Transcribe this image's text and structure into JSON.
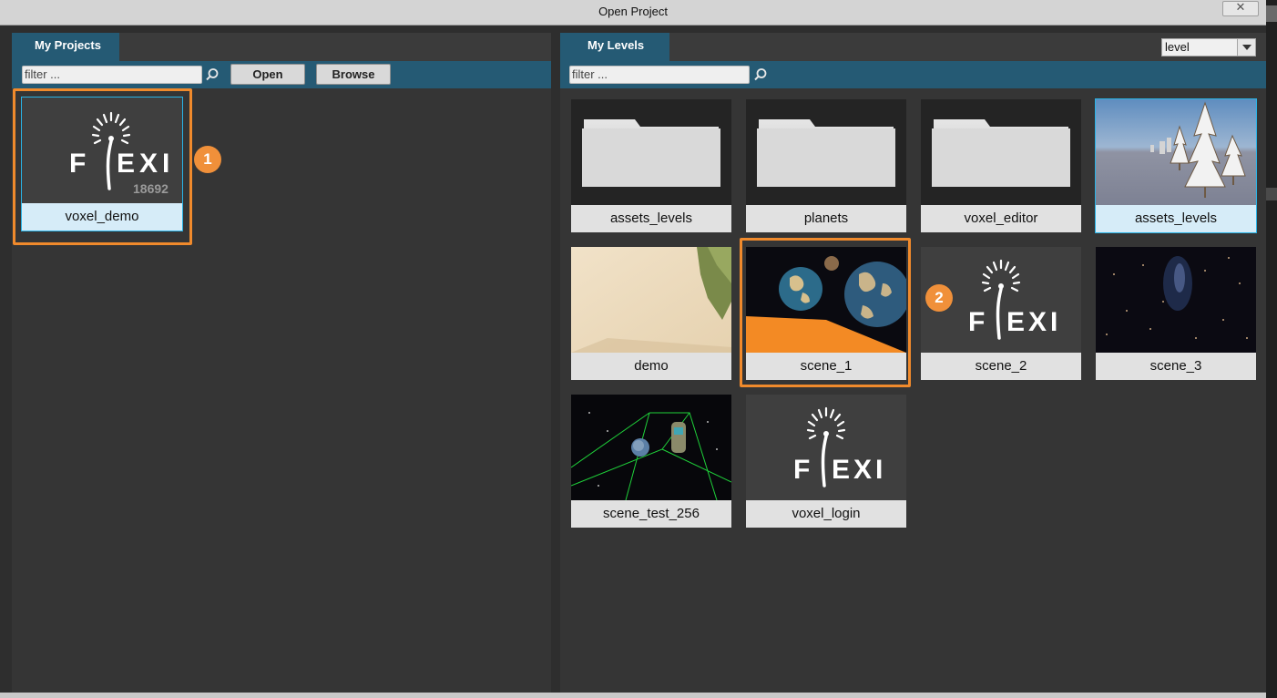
{
  "window": {
    "title": "Open Project",
    "close_glyph": "✕"
  },
  "projects": {
    "tab_label": "My Projects",
    "filter_placeholder": "filter ...",
    "open_label": "Open",
    "browse_label": "Browse",
    "items": [
      {
        "name": "voxel_demo",
        "thumb_number": "18692",
        "icon": "flexi-logo",
        "selected": true
      }
    ]
  },
  "levels": {
    "tab_label": "My Levels",
    "filter_placeholder": "filter ...",
    "type_select_value": "level",
    "items": [
      {
        "name": "assets_levels",
        "thumb": "folder-icon"
      },
      {
        "name": "planets",
        "thumb": "folder-icon"
      },
      {
        "name": "voxel_editor",
        "thumb": "folder-icon"
      },
      {
        "name": "assets_levels",
        "thumb": "snow-trees-scene",
        "selected": true
      },
      {
        "name": "demo",
        "thumb": "desert-scene"
      },
      {
        "name": "scene_1",
        "thumb": "planets-scene"
      },
      {
        "name": "scene_2",
        "thumb": "flexi-logo"
      },
      {
        "name": "scene_3",
        "thumb": "nebula-scene"
      },
      {
        "name": "scene_test_256",
        "thumb": "space-wireframe-scene"
      },
      {
        "name": "voxel_login",
        "thumb": "flexi-logo"
      }
    ]
  },
  "annotations": {
    "badge_1": "1",
    "badge_2": "2"
  },
  "colors": {
    "tab_blue": "#255a74",
    "highlight_orange": "#f08a2c",
    "selection_cyan": "#29b3e6"
  }
}
